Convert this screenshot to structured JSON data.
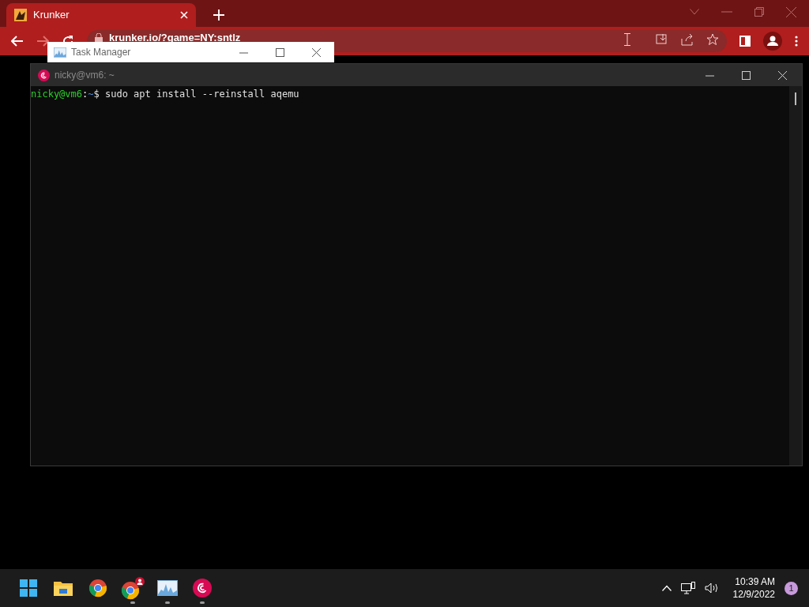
{
  "browser": {
    "tab": {
      "title": "Krunker",
      "selected": true
    },
    "url": "krunker.io/?game=NY:sntlz"
  },
  "task_manager": {
    "title": "Task Manager"
  },
  "terminal": {
    "title": "nicky@vm6: ~",
    "prompt_user": "nicky@vm6",
    "prompt_path": ":~",
    "prompt_sign": "$",
    "command": " sudo apt install --reinstall aqemu"
  },
  "taskbar": {
    "apps": [
      {
        "kind": "start",
        "running": false
      },
      {
        "kind": "files",
        "running": false
      },
      {
        "kind": "chrome",
        "running": false
      },
      {
        "kind": "chrome-profile",
        "running": true
      },
      {
        "kind": "taskmgr",
        "running": true
      },
      {
        "kind": "debian",
        "running": true
      }
    ],
    "time": "10:39 AM",
    "date": "12/9/2022",
    "notifications": "1"
  }
}
